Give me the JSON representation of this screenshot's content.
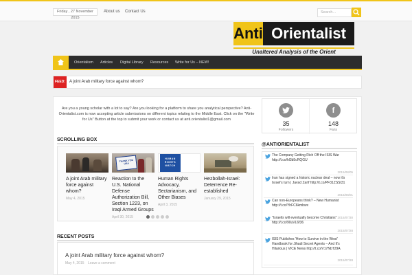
{
  "topbar": {
    "date": "Friday , 27 November 2015",
    "links": [
      "About us",
      "Contact Us"
    ],
    "search_placeholder": "Search..."
  },
  "logo": {
    "anti": "Anti",
    "orientalist": "Orientalist",
    "tagline": "Unaltered Analysis of the Orient"
  },
  "nav": {
    "items": [
      "Orientalism",
      "Articles",
      "Digital Library",
      "Resources",
      "Write for Us – NEW!"
    ]
  },
  "feed": {
    "label": "FEED:",
    "text": "A joint Arab military force against whom?"
  },
  "intro": {
    "text": "Are you a young scholar with a lot to say? Are you looking for a platform to share you analytical perspective? Anti-Orientalist.com is now accepting article submissions on different topics relating to the Middle East. Click on the \"Write for Us\" Button at the top to submit your work or contact us at anti.orientalist1@gmail.com"
  },
  "scrolling": {
    "title": "SCROLLING BOX",
    "items": [
      {
        "title": "A joint Arab military force against whom?",
        "date": "May 4, 2015"
      },
      {
        "title": "Reaction to the U.S. National Defense Authorization Bill, Section 1223, on Iraqi Armed Groups",
        "date": "April 30, 2015"
      },
      {
        "title": "Human Rights Advocacy, Sectarianism, and Other Biases",
        "date": "April 3, 2015"
      },
      {
        "title": "Hezbollah-Israel: Deterrence Re-established",
        "date": "January 29, 2015"
      }
    ],
    "thumb_texts": {
      "usa_sign": "THANK YOU USA",
      "hrw": "HUMAN RIGHTS WATCH"
    }
  },
  "recent": {
    "title": "RECENT POSTS",
    "post_title": "A joint Arab military force against whom?",
    "post_date": "May 4, 2015",
    "post_comment": "Leave a comment"
  },
  "social": {
    "twitter": {
      "count": "35",
      "label": "Followers"
    },
    "facebook": {
      "count": "148",
      "label": "Fans"
    }
  },
  "twitter_feed": {
    "title": "@ANTIORIENTALIST",
    "tweets": [
      {
        "text": "The Company Getting Rich Off the ISIS War http://t.co/hl3b5cRQGU",
        "date": "2015/08/05"
      },
      {
        "text": "Iran has signed a historic nuclear deal – now it's Israel's turn | Javad Zarif http://t.co/PF31ZSSt31",
        "date": "2015/08/01"
      },
      {
        "text": "Can non-Europeans think? – New Humanist http://t.co/YhFC6kmbwx",
        "date": "2015/07/30"
      },
      {
        "text": "\"Israelis will eventually become Christians\" http://t.co/90uVL6f36",
        "date": "2015/07/28"
      },
      {
        "text": "ISIS Publishes 'How to Survive in the West' Handbook for Jihadi Secret Agents – And It's Hilarious | VICE News http://t.co/V17NbT29A",
        "date": "2015/07/28"
      }
    ]
  },
  "colors": {
    "accent": "#f0c419",
    "nav_bg": "#2d2d2d",
    "feed_label": "#dd2222"
  }
}
